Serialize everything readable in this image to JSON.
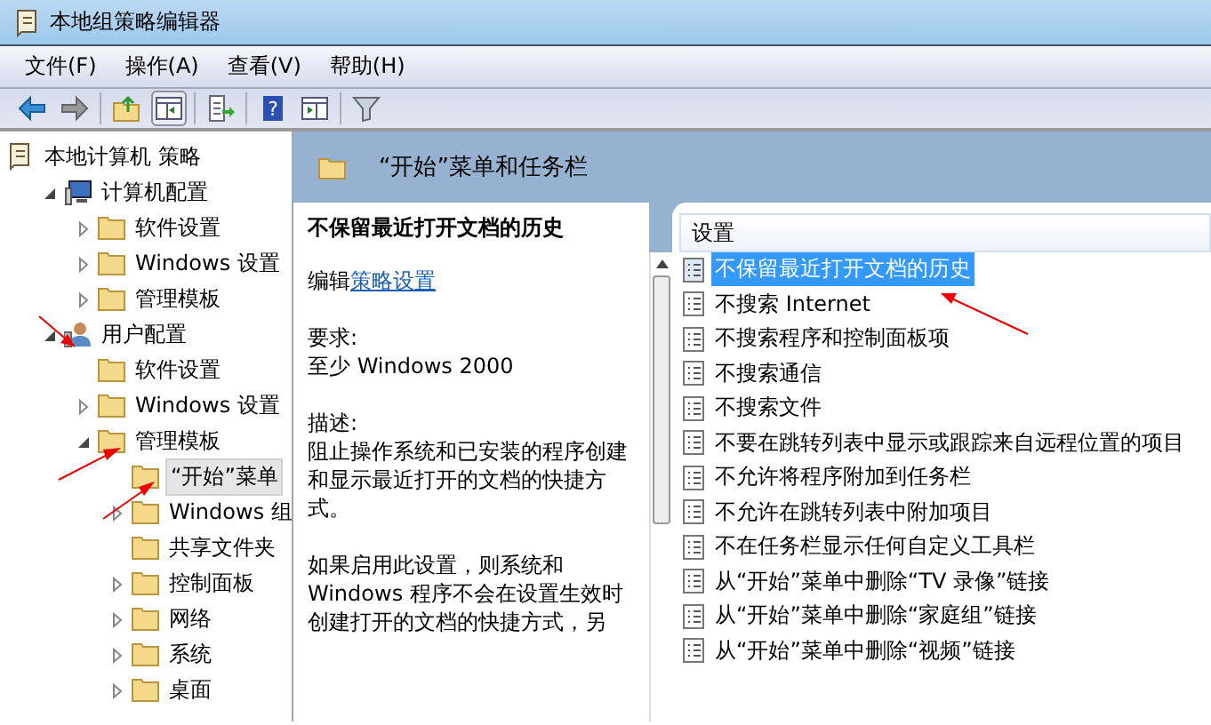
{
  "window": {
    "title": "本地组策略编辑器"
  },
  "menu": [
    "文件(F)",
    "操作(A)",
    "查看(V)",
    "帮助(H)"
  ],
  "toolbar": [
    {
      "kind": "back"
    },
    {
      "kind": "forward"
    },
    {
      "kind": "sep"
    },
    {
      "kind": "up"
    },
    {
      "kind": "pane",
      "selected": true
    },
    {
      "kind": "sep"
    },
    {
      "kind": "export"
    },
    {
      "kind": "sep"
    },
    {
      "kind": "help",
      "glyph": "?"
    },
    {
      "kind": "view"
    },
    {
      "kind": "sep"
    },
    {
      "kind": "filter"
    }
  ],
  "tree": [
    {
      "label": "本地计算机 策略",
      "kind": "policy",
      "selected": false,
      "children": [
        {
          "label": "计算机配置",
          "kind": "computer",
          "expanded": true,
          "selected": false,
          "children": [
            {
              "label": "软件设置",
              "kind": "folder",
              "expanded": false,
              "selected": false
            },
            {
              "label": "Windows 设置",
              "kind": "folder",
              "expanded": false,
              "selected": false
            },
            {
              "label": "管理模板",
              "kind": "folder",
              "expanded": false,
              "selected": false
            }
          ]
        },
        {
          "label": "用户配置",
          "kind": "user",
          "expanded": true,
          "selected": false,
          "children": [
            {
              "label": "软件设置",
              "kind": "folder",
              "selected": false
            },
            {
              "label": "Windows 设置",
              "kind": "folder",
              "expanded": false,
              "selected": false
            },
            {
              "label": "管理模板",
              "kind": "folder",
              "expanded": true,
              "selected": false,
              "children": [
                {
                  "label": "“开始”菜单",
                  "kind": "folder",
                  "selected": true
                },
                {
                  "label": "Windows 组",
                  "kind": "folder",
                  "expanded": false,
                  "selected": false
                },
                {
                  "label": "共享文件夹",
                  "kind": "folder",
                  "selected": false
                },
                {
                  "label": "控制面板",
                  "kind": "folder",
                  "expanded": false,
                  "selected": false
                },
                {
                  "label": "网络",
                  "kind": "folder",
                  "expanded": false,
                  "selected": false
                },
                {
                  "label": "系统",
                  "kind": "folder",
                  "expanded": false,
                  "selected": false
                },
                {
                  "label": "桌面",
                  "kind": "folder",
                  "expanded": false,
                  "selected": false
                }
              ]
            }
          ]
        }
      ]
    }
  ],
  "header": {
    "title": "“开始”菜单和任务栏"
  },
  "detail": {
    "title": "不保留最近打开文档的历史",
    "edit_prefix": "编辑",
    "edit_link": "策略设置",
    "requirements_label": "要求:",
    "requirements": "至少 Windows 2000",
    "description_label": "描述:",
    "paragraphs": [
      "阻止操作系统和已安装的程序创建和显示最近打开的文档的快捷方式。",
      "如果启用此设置，则系统和 Windows 程序不会在设置生效时创建打开的文档的快捷方式，另"
    ]
  },
  "list": {
    "columns": [
      "设置"
    ],
    "rows": [
      {
        "label": "不保留最近打开文档的历史",
        "selected": true
      },
      {
        "label": "不搜索 Internet",
        "selected": false
      },
      {
        "label": "不搜索程序和控制面板项",
        "selected": false
      },
      {
        "label": "不搜索通信",
        "selected": false
      },
      {
        "label": "不搜索文件",
        "selected": false
      },
      {
        "label": "不要在跳转列表中显示或跟踪来自远程位置的项目",
        "selected": false
      },
      {
        "label": "不允许将程序附加到任务栏",
        "selected": false
      },
      {
        "label": "不允许在跳转列表中附加项目",
        "selected": false
      },
      {
        "label": "不在任务栏显示任何自定义工具栏",
        "selected": false
      },
      {
        "label": "从“开始”菜单中删除“TV 录像”链接",
        "selected": false
      },
      {
        "label": "从“开始”菜单中删除“家庭组”链接",
        "selected": false
      },
      {
        "label": "从“开始”菜单中删除“视频”链接",
        "selected": false
      }
    ]
  }
}
